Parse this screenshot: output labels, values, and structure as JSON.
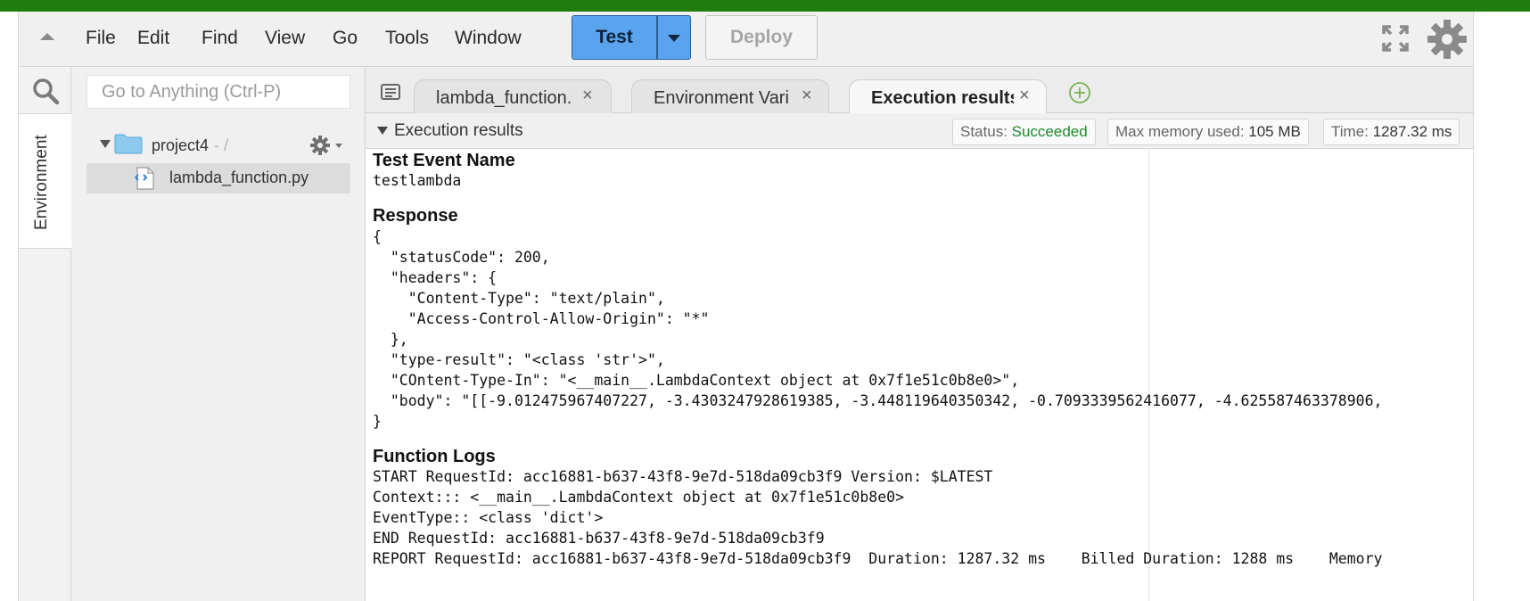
{
  "menubar": {
    "items": [
      "File",
      "Edit",
      "Find",
      "View",
      "Go",
      "Tools",
      "Window"
    ],
    "test_label": "Test",
    "deploy_label": "Deploy"
  },
  "rail": {
    "environment_label": "Environment"
  },
  "sidebar": {
    "search_placeholder": "Go to Anything (Ctrl-P)",
    "project_name": "project4",
    "project_path": " - /",
    "file_name": "lambda_function.py"
  },
  "tabs": [
    {
      "label": "lambda_function.",
      "close": "×"
    },
    {
      "label": "Environment Vari",
      "close": "×"
    },
    {
      "label": "Execution results",
      "close": "×"
    }
  ],
  "results": {
    "title": "Execution results",
    "status_label": "Status: ",
    "status_value": "Succeeded",
    "memory_label": "Max memory used: ",
    "memory_value": "105 MB",
    "time_label": "Time: ",
    "time_value": "1287.32 ms"
  },
  "output": {
    "test_event_heading": "Test Event Name",
    "test_event_name": "testlambda",
    "response_heading": "Response",
    "response_lines": [
      "{",
      "  \"statusCode\": 200,",
      "  \"headers\": {",
      "    \"Content-Type\": \"text/plain\",",
      "    \"Access-Control-Allow-Origin\": \"*\"",
      "  },",
      "  \"type-result\": \"<class 'str'>\",",
      "  \"COntent-Type-In\": \"<__main__.LambdaContext object at 0x7f1e51c0b8e0>\",",
      "  \"body\": \"[[-9.012475967407227, -3.4303247928619385, -3.448119640350342, -0.7093339562416077, -4.625587463378906,",
      "}"
    ],
    "logs_heading": "Function Logs",
    "log_lines": [
      "START RequestId: acc16881-b637-43f8-9e7d-518da09cb3f9 Version: $LATEST",
      "Context::: <__main__.LambdaContext object at 0x7f1e51c0b8e0>",
      "EventType:: <class 'dict'>",
      "END RequestId: acc16881-b637-43f8-9e7d-518da09cb3f9",
      "REPORT RequestId: acc16881-b637-43f8-9e7d-518da09cb3f9  Duration: 1287.32 ms    Billed Duration: 1288 ms    Memory"
    ]
  },
  "colors": {
    "top_bar": "#1e7d0d",
    "test_button": "#5aa4ef",
    "status_ok": "#1e8b2a",
    "folder": "#8ec9f0"
  }
}
